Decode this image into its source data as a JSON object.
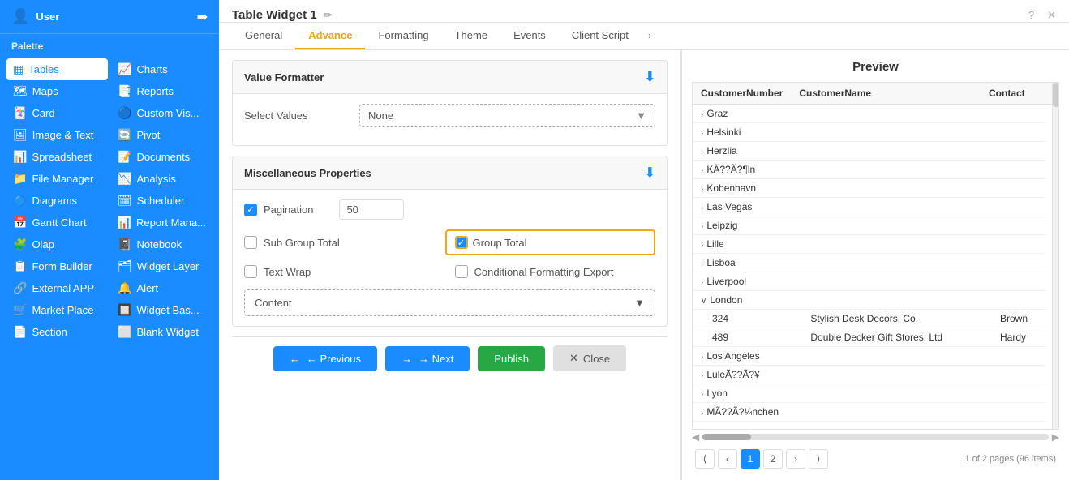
{
  "sidebar": {
    "title": "User",
    "palette_label": "Palette",
    "items_col1": [
      {
        "id": "tables",
        "icon": "▦",
        "label": "Tables",
        "active": true
      },
      {
        "id": "maps",
        "icon": "🗺",
        "label": "Maps"
      },
      {
        "id": "card",
        "icon": "🃏",
        "label": "Card"
      },
      {
        "id": "image-text",
        "icon": "🖼",
        "label": "Image & Text"
      },
      {
        "id": "spreadsheet",
        "icon": "📊",
        "label": "Spreadsheet"
      },
      {
        "id": "file-manager",
        "icon": "📁",
        "label": "File Manager"
      },
      {
        "id": "diagrams",
        "icon": "🔷",
        "label": "Diagrams"
      },
      {
        "id": "gantt-chart",
        "icon": "📅",
        "label": "Gantt Chart"
      },
      {
        "id": "olap",
        "icon": "🧩",
        "label": "Olap"
      },
      {
        "id": "form-builder",
        "icon": "📋",
        "label": "Form Builder"
      },
      {
        "id": "external-app",
        "icon": "🔗",
        "label": "External APP"
      },
      {
        "id": "market-place",
        "icon": "🛒",
        "label": "Market Place"
      },
      {
        "id": "section",
        "icon": "📄",
        "label": "Section"
      }
    ],
    "items_col2": [
      {
        "id": "charts",
        "icon": "📈",
        "label": "Charts"
      },
      {
        "id": "reports",
        "icon": "📑",
        "label": "Reports"
      },
      {
        "id": "custom-vis",
        "icon": "🔵",
        "label": "Custom Vis..."
      },
      {
        "id": "pivot",
        "icon": "🔄",
        "label": "Pivot"
      },
      {
        "id": "documents",
        "icon": "📝",
        "label": "Documents"
      },
      {
        "id": "analysis",
        "icon": "📉",
        "label": "Analysis"
      },
      {
        "id": "scheduler",
        "icon": "🗓",
        "label": "Scheduler"
      },
      {
        "id": "report-mana",
        "icon": "📊",
        "label": "Report Mana..."
      },
      {
        "id": "notebook",
        "icon": "📓",
        "label": "Notebook"
      },
      {
        "id": "widget-layer",
        "icon": "🗂",
        "label": "Widget Layer"
      },
      {
        "id": "alert",
        "icon": "🔔",
        "label": "Alert"
      },
      {
        "id": "widget-bas",
        "icon": "🔲",
        "label": "Widget Bas..."
      },
      {
        "id": "blank-widget",
        "icon": "⬜",
        "label": "Blank Widget"
      }
    ]
  },
  "title_bar": {
    "title": "Table Widget 1",
    "edit_icon": "✏"
  },
  "tabs": [
    {
      "id": "general",
      "label": "General"
    },
    {
      "id": "advance",
      "label": "Advance",
      "active": true
    },
    {
      "id": "formatting",
      "label": "Formatting"
    },
    {
      "id": "theme",
      "label": "Theme"
    },
    {
      "id": "events",
      "label": "Events"
    },
    {
      "id": "client-script",
      "label": "Client Script"
    },
    {
      "id": "more",
      "label": "›"
    }
  ],
  "value_formatter": {
    "title": "Value Formatter",
    "select_values_label": "Select Values",
    "select_values_value": "None"
  },
  "misc_properties": {
    "title": "Miscellaneous Properties",
    "pagination_label": "Pagination",
    "pagination_checked": true,
    "pagination_value": "50",
    "sub_group_total_label": "Sub Group Total",
    "sub_group_total_checked": false,
    "group_total_label": "Group Total",
    "group_total_checked": true,
    "text_wrap_label": "Text Wrap",
    "text_wrap_checked": false,
    "conditional_formatting_export_label": "Conditional Formatting Export",
    "conditional_formatting_export_checked": false
  },
  "content_dropdown": {
    "value": "Content",
    "arrow": "▼"
  },
  "buttons": {
    "previous": "← Previous",
    "next": "→ Next",
    "publish": "Publish",
    "close": "✕ Close"
  },
  "preview": {
    "title": "Preview",
    "columns": [
      {
        "label": "CustomerNumber"
      },
      {
        "label": "CustomerName"
      },
      {
        "label": "Contact"
      }
    ],
    "rows": [
      {
        "type": "group",
        "label": "Graz",
        "expanded": false
      },
      {
        "type": "group",
        "label": "Helsinki",
        "expanded": false
      },
      {
        "type": "group",
        "label": "Herzlia",
        "expanded": false
      },
      {
        "type": "group",
        "label": "KÃ??Ã?¶ln",
        "expanded": false
      },
      {
        "type": "group",
        "label": "Kobenhavn",
        "expanded": false
      },
      {
        "type": "group",
        "label": "Las Vegas",
        "expanded": false
      },
      {
        "type": "group",
        "label": "Leipzig",
        "expanded": false
      },
      {
        "type": "group",
        "label": "Lille",
        "expanded": false
      },
      {
        "type": "group",
        "label": "Lisboa",
        "expanded": false
      },
      {
        "type": "group",
        "label": "Liverpool",
        "expanded": false
      },
      {
        "type": "group",
        "label": "London",
        "expanded": true
      },
      {
        "type": "data",
        "col1": "324",
        "col2": "Stylish Desk Decors, Co.",
        "col3": "Brown"
      },
      {
        "type": "data",
        "col1": "489",
        "col2": "Double Decker Gift Stores, Ltd",
        "col3": "Hardy"
      },
      {
        "type": "group",
        "label": "Los Angeles",
        "expanded": false
      },
      {
        "type": "group",
        "label": "LuleÃ??Ã?¥",
        "expanded": false
      },
      {
        "type": "group",
        "label": "Lyon",
        "expanded": false
      },
      {
        "type": "group",
        "label": "MÃ??Ã?¼nchen",
        "expanded": false
      }
    ],
    "pagination": {
      "pages": [
        "1",
        "2"
      ],
      "active_page": "1",
      "info": "1 of 2 pages (96 items)"
    }
  }
}
